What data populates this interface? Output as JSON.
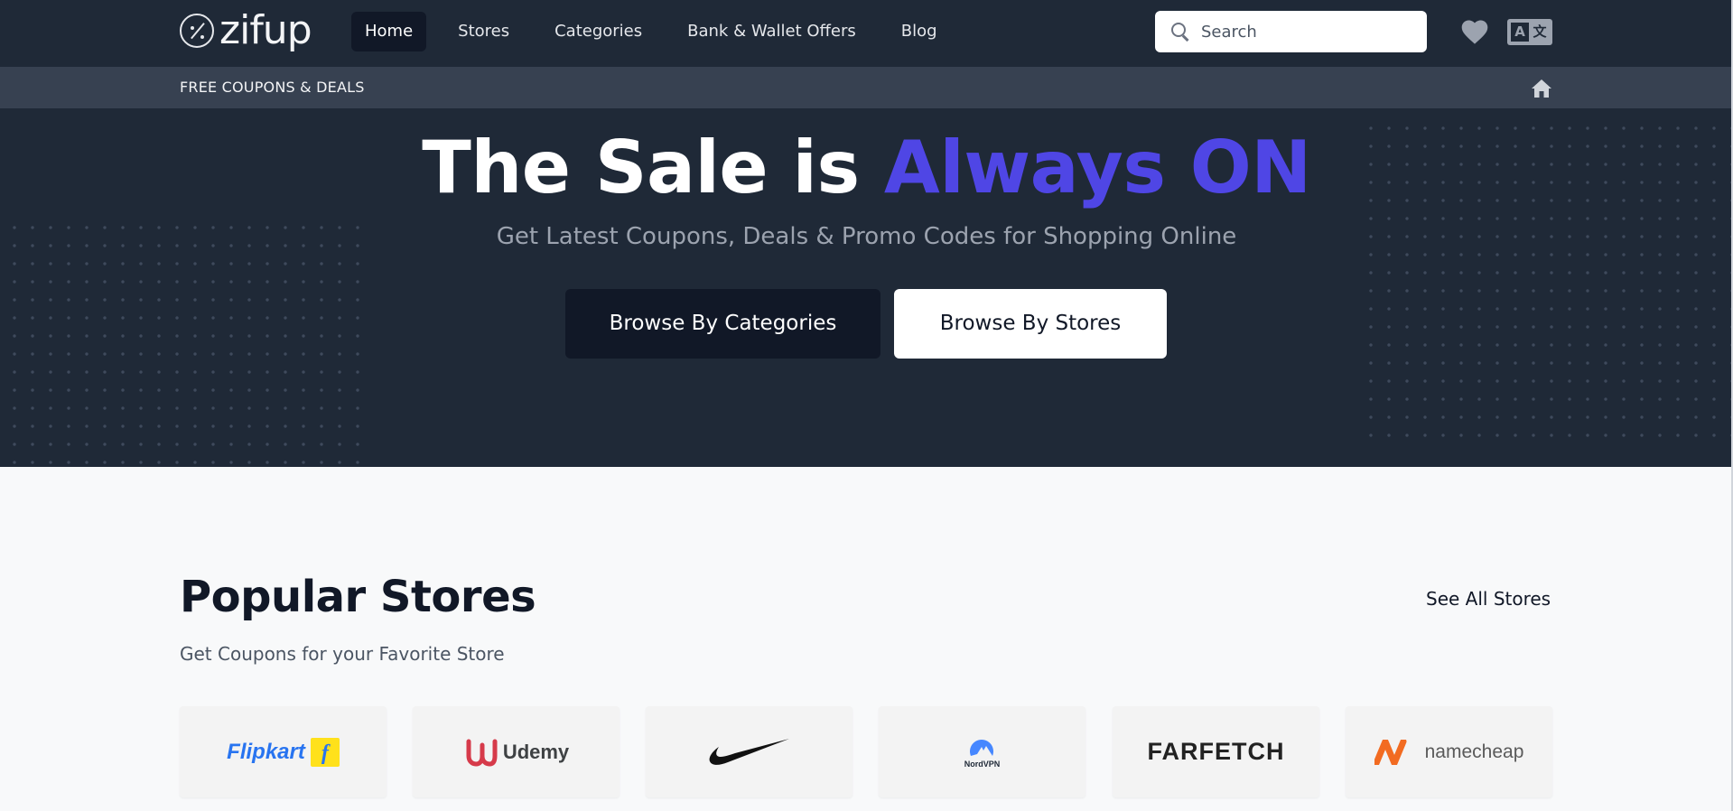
{
  "brand": {
    "logo_text": "zifup",
    "accent": "#4f46e5",
    "nav_bg": "#1f2937"
  },
  "nav": {
    "items": [
      {
        "label": "Home",
        "active": true
      },
      {
        "label": "Stores",
        "active": false
      },
      {
        "label": "Categories",
        "active": false
      },
      {
        "label": "Bank & Wallet Offers",
        "active": false
      },
      {
        "label": "Blog",
        "active": false
      }
    ],
    "search_placeholder": "Search",
    "icons": [
      "search-icon",
      "heart-icon",
      "language-icon"
    ]
  },
  "subbar": {
    "label": "FREE COUPONS & DEALS",
    "icon": "home-icon"
  },
  "hero": {
    "title_main": "The Sale is ",
    "title_accent": "Always ON",
    "subtitle": "Get Latest Coupons, Deals & Promo Codes for Shopping Online",
    "btn_categories": "Browse By Categories",
    "btn_stores": "Browse By Stores"
  },
  "popular": {
    "title": "Popular Stores",
    "subtitle": "Get Coupons for your Favorite Store",
    "see_all": "See All Stores",
    "stores": [
      {
        "name": "Flipkart",
        "logo_text": "Flipkart",
        "logo_mark": "f"
      },
      {
        "name": "Udemy",
        "logo_text": "Udemy"
      },
      {
        "name": "Nike"
      },
      {
        "name": "NordVPN",
        "logo_text": "NordVPN"
      },
      {
        "name": "Farfetch",
        "logo_text": "FARFETCH"
      },
      {
        "name": "Namecheap",
        "logo_text": "namecheap"
      }
    ]
  }
}
